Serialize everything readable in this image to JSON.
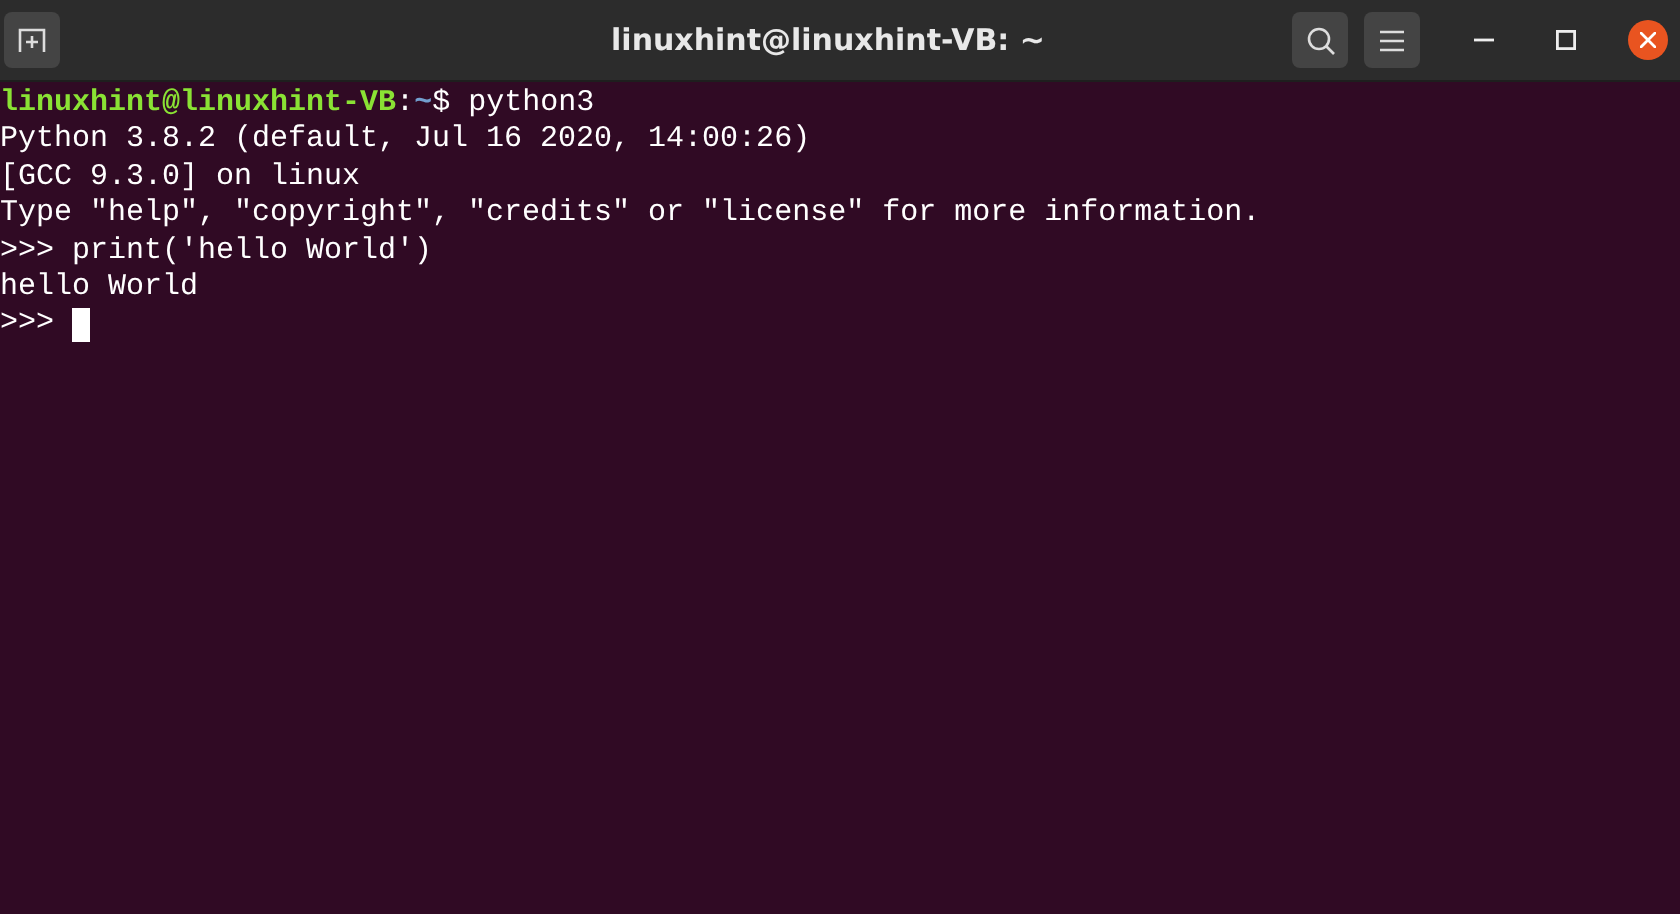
{
  "window": {
    "title": "linuxhint@linuxhint-VB: ~"
  },
  "terminal": {
    "prompt": {
      "user_host": "linuxhint@linuxhint-VB",
      "separator": ":",
      "path": "~",
      "symbol": "$",
      "command": "python3"
    },
    "lines": [
      "Python 3.8.2 (default, Jul 16 2020, 14:00:26)",
      "[GCC 9.3.0] on linux",
      "Type \"help\", \"copyright\", \"credits\" or \"license\" for more information.",
      ">>> print('hello World')",
      "hello World"
    ],
    "input_prompt": ">>>"
  }
}
